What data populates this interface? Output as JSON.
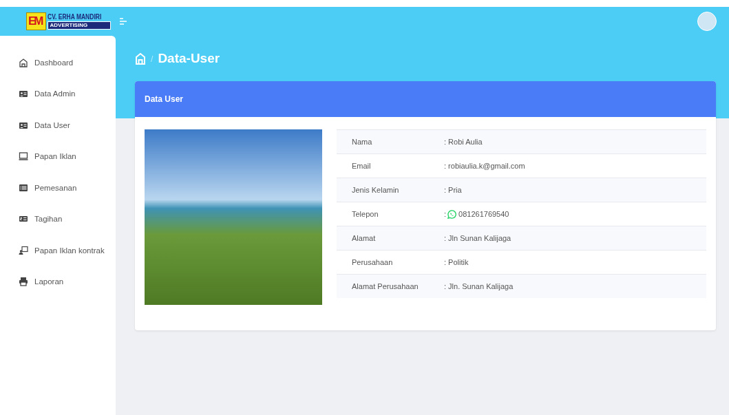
{
  "brand": {
    "mark": "EM",
    "name": "CV. ERHA MANDIRI",
    "tagline": "ADVERTISING"
  },
  "sidebar": {
    "items": [
      {
        "label": "Dashboard",
        "kind": "home",
        "selected": false
      },
      {
        "label": "Data Admin",
        "kind": "card",
        "selected": false
      },
      {
        "label": "Data User",
        "kind": "card",
        "selected": false
      },
      {
        "label": "Papan Iklan",
        "kind": "screen",
        "selected": false
      },
      {
        "label": "Pemesanan",
        "kind": "list",
        "selected": false
      },
      {
        "label": "Tagihan",
        "kind": "bill",
        "selected": false
      },
      {
        "label": "Papan Iklan kontrak",
        "kind": "contract",
        "selected": false
      },
      {
        "label": "Laporan",
        "kind": "print",
        "selected": false
      }
    ]
  },
  "breadcrumb_separator": "/",
  "page_title": "Data-User",
  "card": {
    "title": "Data User",
    "rows": [
      {
        "label": "Nama",
        "value": ": Robi Aulia"
      },
      {
        "label": "Email",
        "value": ": robiaulia.k@gmail.com"
      },
      {
        "label": "Jenis Kelamin",
        "value": ": Pria"
      },
      {
        "label": "Telepon",
        "value": "081261769540",
        "prefix": ":",
        "kind": "phone"
      },
      {
        "label": "Alamat",
        "value": ": Jln Sunan Kalijaga"
      },
      {
        "label": "Perusahaan",
        "value": ": Politik"
      },
      {
        "label": "Alamat Perusahaan",
        "value": ": Jln. Sunan Kalijaga"
      }
    ]
  }
}
